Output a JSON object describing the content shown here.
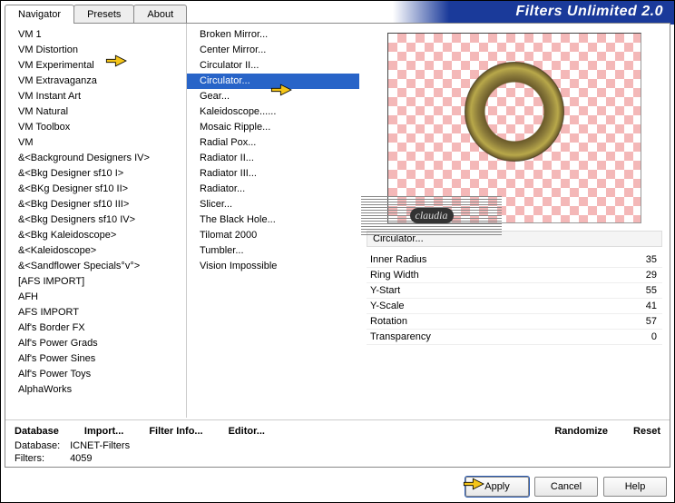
{
  "banner_title": "Filters Unlimited 2.0",
  "tabs": [
    {
      "label": "Navigator",
      "active": true
    },
    {
      "label": "Presets",
      "active": false
    },
    {
      "label": "About",
      "active": false
    }
  ],
  "left_list": [
    "VM 1",
    "VM Distortion",
    "VM Experimental",
    "VM Extravaganza",
    "VM Instant Art",
    "VM Natural",
    "VM Toolbox",
    "VM",
    "&<Background Designers IV>",
    "&<Bkg Designer sf10 I>",
    "&<BKg Designer sf10 II>",
    "&<Bkg Designer sf10 III>",
    "&<Bkg Designers sf10 IV>",
    "&<Bkg Kaleidoscope>",
    "&<Kaleidoscope>",
    "&<Sandflower Specials°v°>",
    "[AFS IMPORT]",
    "AFH",
    "AFS IMPORT",
    "Alf's Border FX",
    "Alf's Power Grads",
    "Alf's Power Sines",
    "Alf's Power Toys",
    "AlphaWorks"
  ],
  "mid_list": [
    "Broken Mirror...",
    "Center Mirror...",
    "Circulator II...",
    "Circulator...",
    "Gear...",
    "Kaleidoscope......",
    "Mosaic Ripple...",
    "Radial Pox...",
    "Radiator II...",
    "Radiator III...",
    "Radiator...",
    "Slicer...",
    "The Black Hole...",
    "Tilomat 2000",
    "Tumbler...",
    "Vision Impossible"
  ],
  "mid_selected_index": 3,
  "filter_title": "Circulator...",
  "watermark_text": "claudia",
  "params": [
    {
      "label": "Inner Radius",
      "value": "35"
    },
    {
      "label": "Ring Width",
      "value": "29"
    },
    {
      "label": "Y-Start",
      "value": "55"
    },
    {
      "label": "Y-Scale",
      "value": "41"
    },
    {
      "label": "Rotation",
      "value": "57"
    },
    {
      "label": "Transparency",
      "value": "0"
    }
  ],
  "bottom_left": [
    "Database",
    "Import...",
    "Filter Info...",
    "Editor..."
  ],
  "bottom_right": [
    "Randomize",
    "Reset"
  ],
  "status": {
    "db_label": "Database:",
    "db_value": "ICNET-Filters",
    "filters_label": "Filters:",
    "filters_value": "4059"
  },
  "footer_buttons": {
    "apply": "Apply",
    "cancel": "Cancel",
    "help": "Help"
  }
}
